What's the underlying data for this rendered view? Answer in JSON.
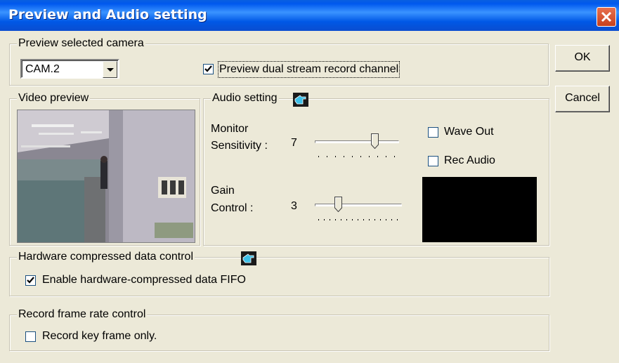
{
  "window": {
    "title": "Preview and Audio setting"
  },
  "buttons": {
    "ok": "OK",
    "cancel": "Cancel"
  },
  "camera_group": {
    "legend": "Preview selected camera",
    "camera_select_value": "CAM.2",
    "dual_stream_label": "Preview dual stream record channel",
    "dual_stream_checked": true
  },
  "video_group": {
    "legend": "Video preview"
  },
  "audio_group": {
    "legend": "Audio setting",
    "monitor_label_line1": "Monitor",
    "monitor_label_line2": "Sensitivity :",
    "monitor_value": "7",
    "monitor_level": 7,
    "gain_label_line1": "Gain",
    "gain_label_line2": "Control :",
    "gain_value": "3",
    "gain_level": 3,
    "wave_out_label": "Wave Out",
    "wave_out_checked": false,
    "rec_audio_label": "Rec Audio",
    "rec_audio_checked": false
  },
  "hardware_group": {
    "legend": "Hardware compressed data control",
    "fifo_label": "Enable hardware-compressed data FIFO",
    "fifo_checked": true
  },
  "frame_rate_group": {
    "legend": "Record frame rate control",
    "key_frame_label": "Record key frame only.",
    "key_frame_checked": false
  },
  "icons": {
    "close": "close-icon",
    "combo_arrow": "chevron-down-icon",
    "help": "pointing-hand-icon",
    "check": "checkmark-icon"
  }
}
